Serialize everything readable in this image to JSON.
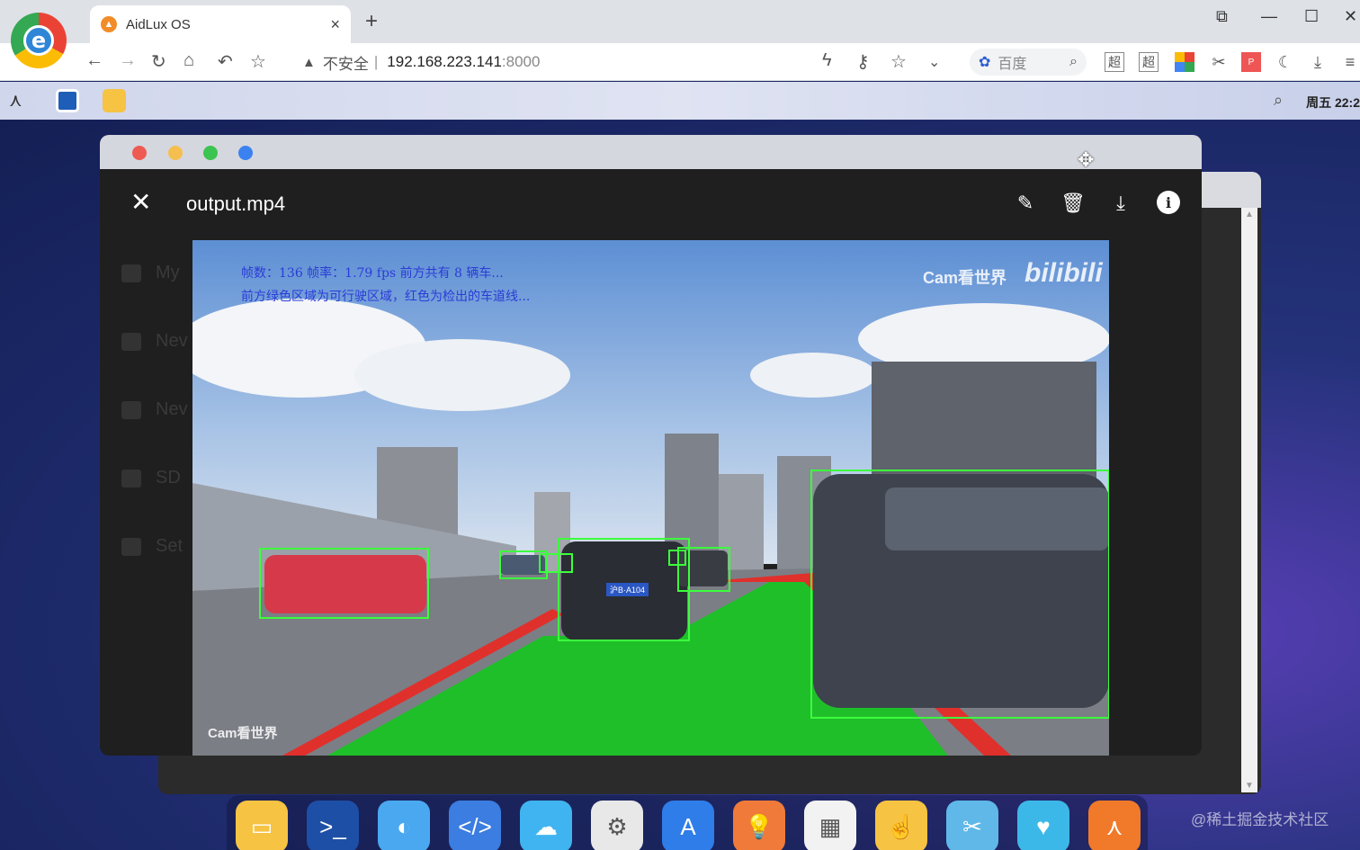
{
  "browser": {
    "tab_title": "AidLux OS",
    "tab_close": "×",
    "new_tab": "+",
    "address_insecure": "不安全",
    "address_separator": "|",
    "address_host": "192.168.223.141",
    "address_port": ":8000",
    "search_engine": "百度",
    "logo_letter": "e"
  },
  "os_bar": {
    "clock": "周五 22:2"
  },
  "viewer": {
    "title": "output.mp4",
    "close_glyph": "✕",
    "edit_glyph": "✎",
    "delete_glyph": "🗑",
    "download_glyph": "⤓",
    "info_glyph": "i"
  },
  "sidebar_ghost": [
    "My",
    "Nev",
    "Nev",
    "SD",
    "Set"
  ],
  "video": {
    "line1": "帧数：136  帧率：1.79 fps 前方共有 8 辆车...",
    "line2": "前方绿色区域为可行驶区域，红色为检出的车道线...",
    "watermark_top": "Cam看世界",
    "watermark_brand": "bilibili",
    "watermark_bottom": "Cam看世界",
    "plate": "沪B·A104"
  },
  "dock_apps": [
    {
      "name": "files",
      "color": "#f6c343",
      "glyph": "▭"
    },
    {
      "name": "terminal",
      "color": "#1e4fa6",
      "glyph": ">_"
    },
    {
      "name": "browser",
      "color": "#4aa8f0",
      "glyph": "◐"
    },
    {
      "name": "code",
      "color": "#3b7de0",
      "glyph": "</>"
    },
    {
      "name": "cloud",
      "color": "#3fb4f0",
      "glyph": "☁"
    },
    {
      "name": "settings",
      "color": "#e8e8e8",
      "glyph": "⚙"
    },
    {
      "name": "app-store",
      "color": "#2f7de8",
      "glyph": "A"
    },
    {
      "name": "tips",
      "color": "#f07a3a",
      "glyph": "💡"
    },
    {
      "name": "calculator",
      "color": "#f2f2f2",
      "glyph": "▦"
    },
    {
      "name": "touch",
      "color": "#f6c343",
      "glyph": "☝"
    },
    {
      "name": "tools",
      "color": "#5fb8e8",
      "glyph": "✂"
    },
    {
      "name": "heart",
      "color": "#3cb8e8",
      "glyph": "♥"
    },
    {
      "name": "aidlux",
      "color": "#f07a2a",
      "glyph": "⋏"
    }
  ],
  "corner_watermark": "@稀土掘金技术社区",
  "colors": {
    "drivable": "#1fbf2a",
    "lane": "#e0302c",
    "box": "#3cff3c",
    "overlay_text": "#2a3cd6"
  }
}
